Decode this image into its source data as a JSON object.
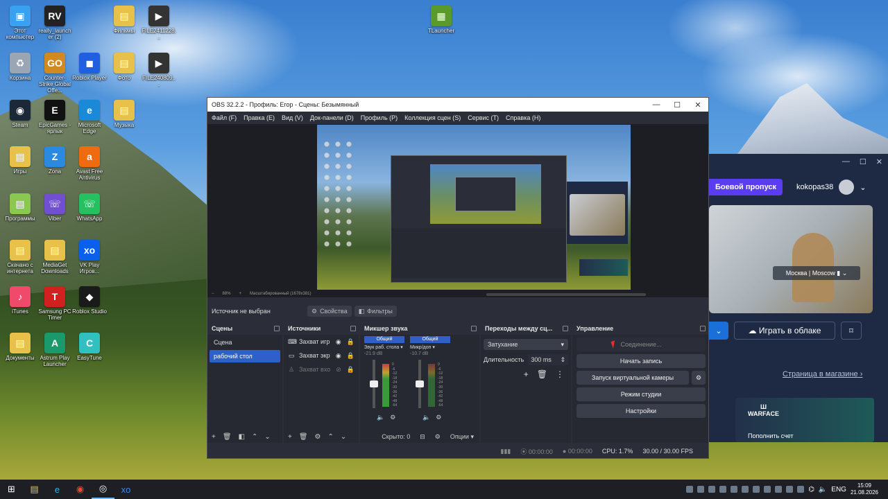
{
  "desktop": {
    "icons": [
      {
        "label": "Этот компьютер",
        "icon": "computer-icon",
        "color": "#3aa0f0",
        "glyph": "▣"
      },
      {
        "label": "really_launcher (2)",
        "icon": "rv-icon",
        "color": "#222222",
        "glyph": "RV"
      },
      {
        "label": "Фильмы",
        "icon": "folder-icon",
        "color": "#e8c14a",
        "glyph": "▤"
      },
      {
        "label": "FILE2411228...",
        "icon": "video-file-icon",
        "color": "#333333",
        "glyph": "▶"
      },
      {
        "label": "Корзина",
        "icon": "recycle-bin-icon",
        "color": "#9aa6b4",
        "glyph": "♻"
      },
      {
        "label": "Counter-Strike Global Offe...",
        "icon": "csgo-icon",
        "color": "#d08a20",
        "glyph": "GO"
      },
      {
        "label": "Roblox Player",
        "icon": "roblox-icon",
        "color": "#2060e0",
        "glyph": "◼"
      },
      {
        "label": "Фото",
        "icon": "folder-icon",
        "color": "#e8c14a",
        "glyph": "▤"
      },
      {
        "label": "FILE240809...",
        "icon": "video-file-icon",
        "color": "#333333",
        "glyph": "▶"
      },
      {
        "label": "Steam",
        "icon": "steam-icon",
        "color": "#1b2838",
        "glyph": "◉"
      },
      {
        "label": "EpicGames - ярлык",
        "icon": "epic-icon",
        "color": "#111111",
        "glyph": "E"
      },
      {
        "label": "Microsoft Edge",
        "icon": "edge-icon",
        "color": "#1a8ad8",
        "glyph": "e"
      },
      {
        "label": "Музыка",
        "icon": "folder-icon",
        "color": "#e8c14a",
        "glyph": "▤"
      },
      {
        "label": "Игры",
        "icon": "folder-icon",
        "color": "#e8c14a",
        "glyph": "▤"
      },
      {
        "label": "Zona",
        "icon": "zona-icon",
        "color": "#2a8ae0",
        "glyph": "Z"
      },
      {
        "label": "Avast Free Antivirus",
        "icon": "avast-icon",
        "color": "#f06a10",
        "glyph": "a"
      },
      {
        "label": "Программы",
        "icon": "folder-icon",
        "color": "#8ac850",
        "glyph": "▤"
      },
      {
        "label": "Viber",
        "icon": "viber-icon",
        "color": "#7050d0",
        "glyph": "☏"
      },
      {
        "label": "WhatsApp",
        "icon": "whatsapp-icon",
        "color": "#25c060",
        "glyph": "☏"
      },
      {
        "label": "Скачано с интернета",
        "icon": "folder-icon",
        "color": "#e8c14a",
        "glyph": "▤"
      },
      {
        "label": "MediaGet Downloads",
        "icon": "folder-icon",
        "color": "#e8c14a",
        "glyph": "▤"
      },
      {
        "label": "VK Play Игров...",
        "icon": "vkplay-icon",
        "color": "#0a60e8",
        "glyph": "xo"
      },
      {
        "label": "iTunes",
        "icon": "itunes-icon",
        "color": "#f04a6a",
        "glyph": "♪"
      },
      {
        "label": "Samsung PC Timer",
        "icon": "timer-icon",
        "color": "#d02020",
        "glyph": "T"
      },
      {
        "label": "Roblox Studio",
        "icon": "roblox-studio-icon",
        "color": "#1a1a1a",
        "glyph": "◆"
      },
      {
        "label": "Документы",
        "icon": "folder-icon",
        "color": "#e8c14a",
        "glyph": "▤"
      },
      {
        "label": "Astrum Play Launcher",
        "icon": "astrum-icon",
        "color": "#1a9a6a",
        "glyph": "A"
      },
      {
        "label": "EasyTune",
        "icon": "easytune-icon",
        "color": "#30c0c0",
        "glyph": "C"
      },
      {
        "label": "TLauncher",
        "icon": "minecraft-icon",
        "color": "#5a9a2a",
        "glyph": "▦"
      }
    ]
  },
  "launcher": {
    "battle_pass": "Боевой пропуск",
    "username": "kokopas38",
    "region": "Москва | Moscow",
    "play_cloud": "Играть в облаке",
    "store_link": "Страница в магазине",
    "game_logo": "WARFACE",
    "top_up": "Пополнить счет"
  },
  "obs": {
    "title": "OBS 32.2.2 - Профиль: Егор - Сцены: Безымянный",
    "menu": [
      "Файл (F)",
      "Правка (E)",
      "Вид (V)",
      "Док-панели (D)",
      "Профиль (P)",
      "Коллекция сцен (S)",
      "Сервис (T)",
      "Справка (H)"
    ],
    "preview_status": [
      "88%",
      "Масштабированный (1678x381)"
    ],
    "no_source": "Источник не выбран",
    "properties_btn": "Свойства",
    "filters_btn": "Фильтры",
    "scenes": {
      "title": "Сцены",
      "items": [
        {
          "label": "Сцена",
          "selected": false
        },
        {
          "label": "рабочий стол",
          "selected": true
        }
      ]
    },
    "sources": {
      "title": "Источники",
      "items": [
        {
          "label": "Захват игр",
          "icon": "gamepad-icon"
        },
        {
          "label": "Захват экр",
          "icon": "monitor-icon"
        },
        {
          "label": "Захват вхо",
          "icon": "microphone-icon"
        }
      ]
    },
    "mixer": {
      "title": "Микшер звука",
      "channels": [
        {
          "tag": "Общий",
          "label": "Звук раб. стола",
          "db": "-21.9 dB"
        },
        {
          "tag": "Общий",
          "label": "Микр/доп",
          "db": "-10.7 dB"
        }
      ],
      "scale": [
        "0",
        "-6",
        "-12",
        "-18",
        "-24",
        "-30",
        "-36",
        "-42",
        "-48",
        "-54",
        "-60"
      ],
      "hidden": "Скрыто: 0",
      "options": "Опции"
    },
    "transitions": {
      "title": "Переходы между сц...",
      "selected": "Затухание",
      "duration_label": "Длительность",
      "duration_value": "300 ms"
    },
    "controls": {
      "title": "Управление",
      "connecting": "Соединение...",
      "start_recording": "Начать запись",
      "virtual_camera": "Запуск виртуальной камеры",
      "studio_mode": "Режим студии",
      "settings": "Настройки"
    },
    "status": {
      "stream_time": "00:00:00",
      "rec_time": "00:00:00",
      "cpu": "CPU: 1.7%",
      "fps": "30.00 / 30.00 FPS"
    }
  },
  "taskbar": {
    "lang": "ENG",
    "time": "15:09",
    "date": "21.08.2026"
  }
}
